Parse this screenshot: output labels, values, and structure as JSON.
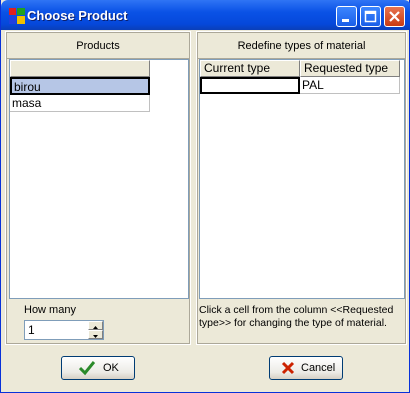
{
  "window": {
    "title": "Choose Product"
  },
  "left": {
    "header": "Products",
    "products": [
      "birou",
      "masa"
    ],
    "quantity_label": "How many",
    "quantity_value": "1"
  },
  "right": {
    "header": "Redefine types of material",
    "columns": [
      "Current type",
      "Requested type"
    ],
    "rows": [
      {
        "current": "",
        "requested": "PAL"
      }
    ],
    "hint": "Click a cell from the column <<Requested type>> for changing the type of material."
  },
  "buttons": {
    "ok": "OK",
    "cancel": "Cancel"
  },
  "colors": {
    "titlebar": "#0a52e6",
    "selection": "#b6c6e6",
    "ok_icon": "#2a8a2a",
    "cancel_icon": "#cc2200"
  }
}
